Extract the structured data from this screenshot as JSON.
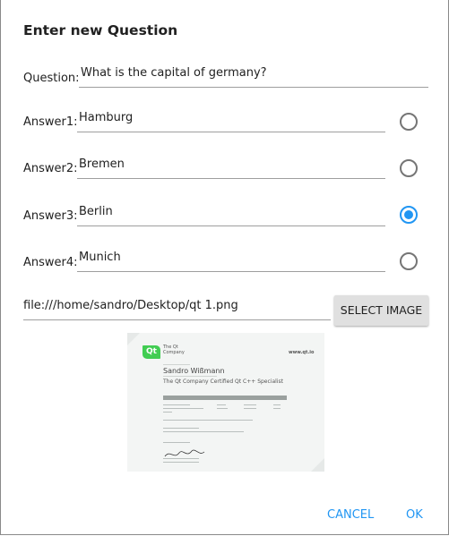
{
  "dialog": {
    "title": "Enter new Question",
    "question": {
      "label": "Question:",
      "value": "What is the capital of germany?"
    },
    "answers": [
      {
        "label": "Answer1:",
        "value": "Hamburg",
        "checked": false
      },
      {
        "label": "Answer2:",
        "value": "Bremen",
        "checked": false
      },
      {
        "label": "Answer3:",
        "value": "Berlin",
        "checked": true
      },
      {
        "label": "Answer4:",
        "value": "Munich",
        "checked": false
      }
    ],
    "image_path": "file:///home/sandro/Desktop/qt 1.png",
    "select_image_label": "SELECT IMAGE",
    "preview": {
      "logo": "Qt",
      "company_line1": "The Qt",
      "company_line2": "Company",
      "url": "www.qt.io",
      "name": "Sandro Wißmann",
      "cert_title": "The Qt Company Certified Qt C++ Specialist"
    },
    "cancel_label": "CANCEL",
    "ok_label": "OK"
  },
  "colors": {
    "accent": "#2196f3",
    "qt_green": "#41cd52",
    "button_bg": "#e0e0e0"
  }
}
